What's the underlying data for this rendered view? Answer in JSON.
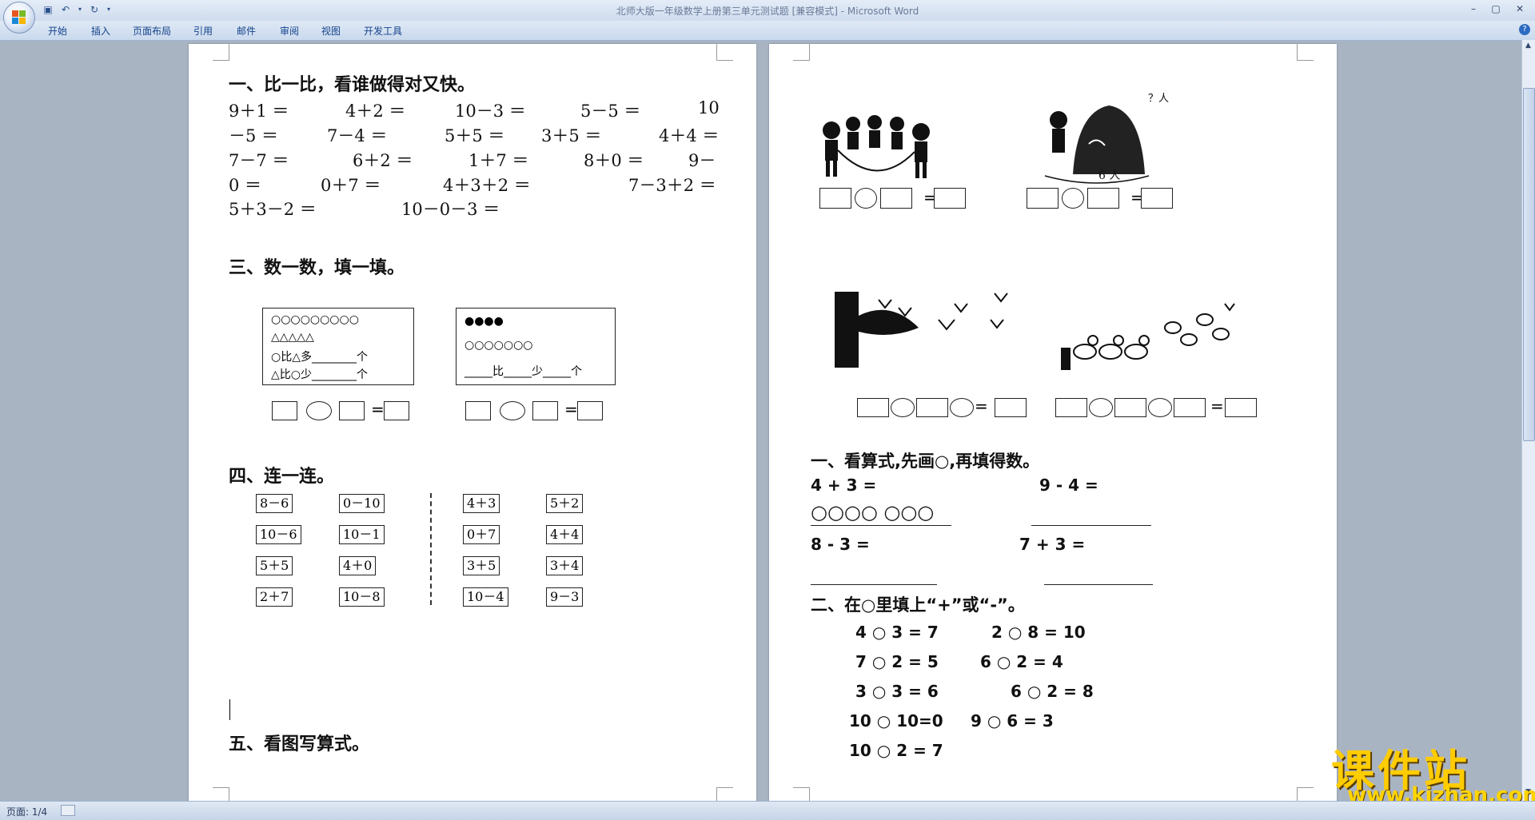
{
  "window": {
    "title": "北师大版一年级数学上册第三单元测试题 [兼容模式] - Microsoft Word"
  },
  "ribbon": {
    "tabs": [
      "开始",
      "插入",
      "页面布局",
      "引用",
      "邮件",
      "审阅",
      "视图",
      "开发工具"
    ]
  },
  "status": {
    "page": "页面: 1/4"
  },
  "watermark": {
    "brand": "课件站",
    "url": "www.kjzhan.com"
  },
  "left_page": {
    "sec1_title": "一、比一比，看谁做得对又快。",
    "sec1_rows": [
      [
        "9＋1 ＝",
        "4＋2 ＝",
        "10－3 ＝",
        "5－5 ＝",
        "10"
      ],
      [
        "－5 ＝",
        "7－4 ＝",
        "5＋5 ＝",
        "3＋5 ＝",
        "4＋4 ＝"
      ],
      [
        "7－7 ＝",
        "6＋2 ＝",
        "1＋7 ＝",
        "8＋0 ＝",
        "9－"
      ],
      [
        "0 ＝",
        "0＋7 ＝",
        "4＋3＋2 ＝",
        "7－3＋2 ＝"
      ],
      [
        "5＋3－2 ＝",
        "10－0－3 ＝"
      ]
    ],
    "sec3_title": "三、数一数，填一填。",
    "box1_lines": [
      "○○○○○○○○○",
      "△△△△△",
      "○比△多________个",
      "△比○少________个"
    ],
    "box2_lines": [
      "●●●●",
      "○○○○○○○",
      "_____比_____少_____个"
    ],
    "sec4_title": "四、连一连。",
    "match_left_a": [
      "8－6",
      "10－6",
      "5＋5",
      "2＋7"
    ],
    "match_left_b": [
      "0－10",
      "10－1",
      "4＋0",
      "10－8"
    ],
    "match_right_a": [
      "4＋3",
      "0＋7",
      "3＋5",
      "10－4"
    ],
    "match_right_b": [
      "5＋2",
      "4＋4",
      "3＋4",
      "9－3"
    ],
    "sec5_title": "五、看图写算式。"
  },
  "right_page": {
    "pic_label_question": "？人",
    "pic_label_total": "6 人",
    "secA_title": "一、看算式,先画○,再填得数。",
    "secA_eq1": "4 + 3 =",
    "secA_eq2": "9 - 4 =",
    "secA_circles": "○○○○  ○○○",
    "secA_eq3": "8 - 3 =",
    "secA_eq4": "7 + 3 =",
    "secB_title": "二、在○里填上“+”或“-”。",
    "secB_rows": [
      [
        "4 ○ 3 = 7",
        "2 ○ 8 = 10"
      ],
      [
        "7 ○ 2 = 5",
        "6 ○ 2 = 4"
      ],
      [
        "3 ○ 3 = 6",
        "6 ○ 2 = 8"
      ],
      [
        "10 ○ 10=0",
        "9 ○ 6 = 3"
      ],
      [
        "10 ○ 2 = 7"
      ]
    ]
  }
}
